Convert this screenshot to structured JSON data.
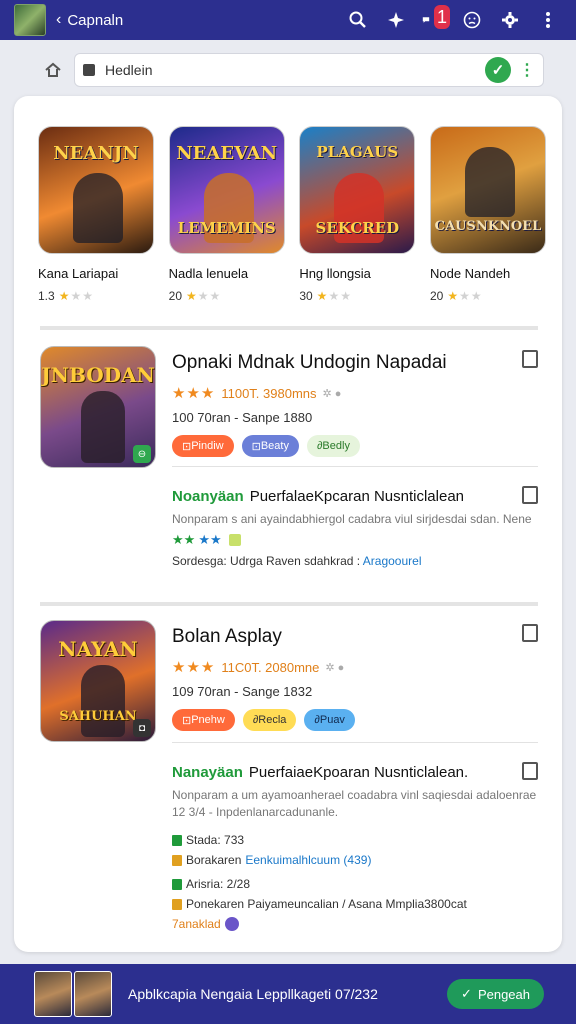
{
  "header": {
    "back_glyph": "‹",
    "title": "Capnaln",
    "notification_count": "1"
  },
  "address_bar": {
    "url": "Hedlein"
  },
  "featured_games": [
    {
      "thumb_title": "NEANJN",
      "name": "Kana Lariapai",
      "rating": "1.3",
      "stars_on": 1,
      "colors": [
        "#6b2d12",
        "#f08a32"
      ]
    },
    {
      "thumb_title": "NEAEVAN",
      "thumb_subtitle": "LEMEMINS",
      "name": "Nadla lenuela",
      "rating": "20",
      "stars_on": 1,
      "colors": [
        "#1d2a8a",
        "#8a4ad0"
      ]
    },
    {
      "thumb_title": "PLAGAUS",
      "thumb_subtitle": "SEKCRED",
      "name": "Hng llongsia",
      "rating": "30",
      "stars_on": 1,
      "colors": [
        "#1a80c8",
        "#c84a2a"
      ]
    },
    {
      "thumb_title": "",
      "thumb_subtitle": "CAUSNKNOEL",
      "name": "Node Nandeh",
      "rating": "20",
      "stars_on": 1,
      "colors": [
        "#c86a18",
        "#3a2a18"
      ]
    }
  ],
  "app_1": {
    "thumb_title": "JNBODAN",
    "title": "Opnaki Mdnak Undogin Napadai",
    "meta": "1100T. 3980mns",
    "sub": "100 70ran - Sanpe 1880",
    "chips": [
      {
        "label": "Pindiw",
        "bg": "#ff6a3a",
        "fg": "#ffffff"
      },
      {
        "label": "Beaty",
        "bg": "#6b7fd8",
        "fg": "#ffffff"
      },
      {
        "label": "Bedly",
        "bg": "#e6f4dc",
        "fg": "#2a7a2a"
      }
    ],
    "colors": [
      "#e08a2a",
      "#3a2a5a"
    ]
  },
  "desc_1": {
    "green_word": "Noanyäan",
    "title": "PuerfalaeKpcaran Nusnticlalean",
    "text": "Nonparam s ani ayaindabhiergol cadabra viul sirjdesdai sdan.               Nene",
    "foot": "Sordesga: Udrga Raven sdahkrad : ",
    "foot_link": "Aragoourel"
  },
  "app_2": {
    "thumb_title": "NAYAN",
    "thumb_subtitle": "SAHUHAN",
    "title": "Bolan Asplay",
    "meta": "11C0T. 2080mne",
    "sub": "109 70ran - Sange 1832",
    "chips": [
      {
        "label": "Pnehw",
        "bg": "#ff6a3a",
        "fg": "#ffffff"
      },
      {
        "label": "Recla",
        "bg": "#ffdc55",
        "fg": "#333333"
      },
      {
        "label": "Puav",
        "bg": "#5ab0f0",
        "fg": "#102a50"
      }
    ],
    "colors": [
      "#5a2a8a",
      "#e0702a"
    ]
  },
  "desc_2": {
    "green_word": "Nanayäan",
    "title": "PuerfaiaeKpoaran Nusnticlalean.",
    "text": "Nonparam a um ayamoanherael coadabra vinl saqiesdai adaloenrae 12 3/4 - Inpdenlanarcadunanle.",
    "stats": [
      {
        "label": "Stada: 733",
        "link": ""
      },
      {
        "label": "Borakaren ",
        "link": "Eenkuimalhlcuum (439)"
      },
      {
        "label": "Arisria: 2/28",
        "link": ""
      },
      {
        "label": "Ponekaren Paiyameuncalian / Asana Mmplia3800cat",
        "link": ""
      },
      {
        "label": "7anaklad",
        "link": ""
      }
    ]
  },
  "bottom_bar": {
    "text": "Apblkcapia Nengaia Leppllkageti 07/232",
    "button": "Pengeah"
  }
}
